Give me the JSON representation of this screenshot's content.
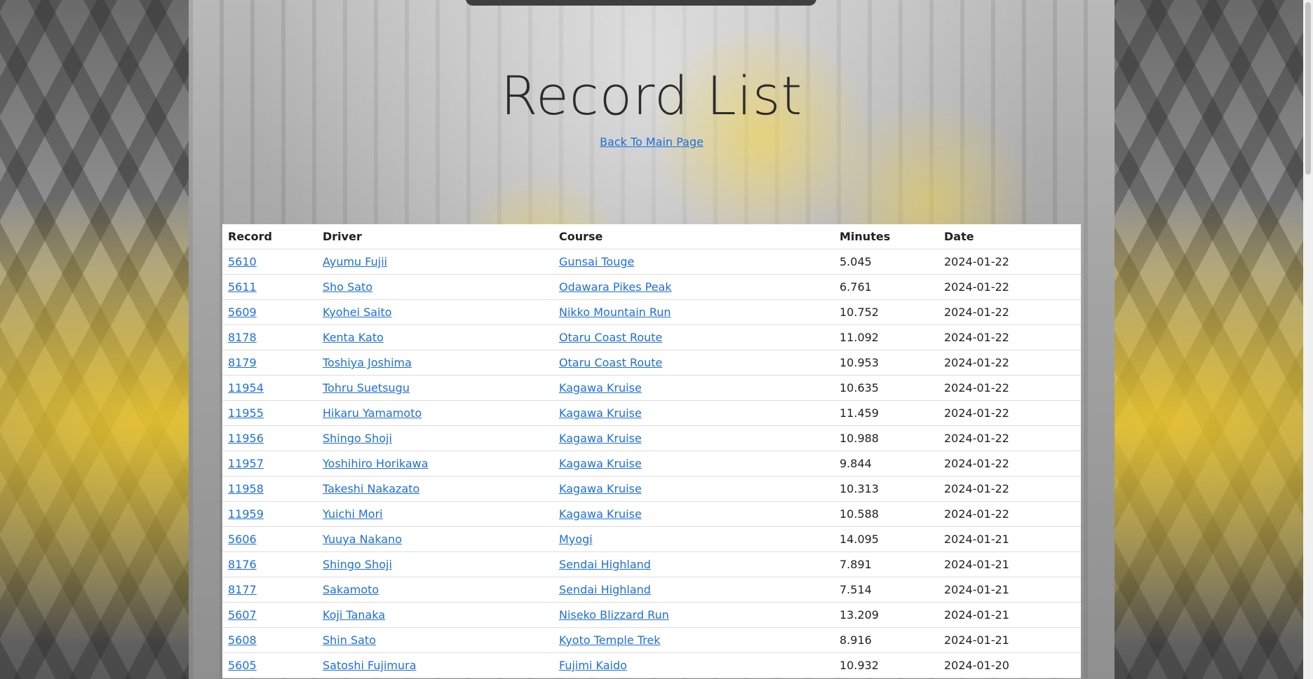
{
  "title": "Record List",
  "back_link": "Back To Main Page",
  "table": {
    "headers": [
      "Record",
      "Driver",
      "Course",
      "Minutes",
      "Date"
    ],
    "rows": [
      {
        "record": "5610",
        "driver": "Ayumu Fujii",
        "course": "Gunsai Touge",
        "minutes": "5.045",
        "date": "2024-01-22"
      },
      {
        "record": "5611",
        "driver": "Sho Sato",
        "course": "Odawara Pikes Peak",
        "minutes": "6.761",
        "date": "2024-01-22"
      },
      {
        "record": "5609",
        "driver": "Kyohei Saito",
        "course": "Nikko Mountain Run",
        "minutes": "10.752",
        "date": "2024-01-22"
      },
      {
        "record": "8178",
        "driver": "Kenta Kato",
        "course": "Otaru Coast Route",
        "minutes": "11.092",
        "date": "2024-01-22"
      },
      {
        "record": "8179",
        "driver": "Toshiya Joshima",
        "course": "Otaru Coast Route",
        "minutes": "10.953",
        "date": "2024-01-22"
      },
      {
        "record": "11954",
        "driver": "Tohru Suetsugu",
        "course": "Kagawa Kruise",
        "minutes": "10.635",
        "date": "2024-01-22"
      },
      {
        "record": "11955",
        "driver": "Hikaru Yamamoto",
        "course": "Kagawa Kruise",
        "minutes": "11.459",
        "date": "2024-01-22"
      },
      {
        "record": "11956",
        "driver": "Shingo Shoji",
        "course": "Kagawa Kruise",
        "minutes": "10.988",
        "date": "2024-01-22"
      },
      {
        "record": "11957",
        "driver": "Yoshihiro Horikawa",
        "course": "Kagawa Kruise",
        "minutes": "9.844",
        "date": "2024-01-22"
      },
      {
        "record": "11958",
        "driver": "Takeshi Nakazato",
        "course": "Kagawa Kruise",
        "minutes": "10.313",
        "date": "2024-01-22"
      },
      {
        "record": "11959",
        "driver": "Yuichi Mori",
        "course": "Kagawa Kruise",
        "minutes": "10.588",
        "date": "2024-01-22"
      },
      {
        "record": "5606",
        "driver": "Yuuya Nakano",
        "course": "Myogi",
        "minutes": "14.095",
        "date": "2024-01-21"
      },
      {
        "record": "8176",
        "driver": "Shingo Shoji",
        "course": "Sendai Highland",
        "minutes": "7.891",
        "date": "2024-01-21"
      },
      {
        "record": "8177",
        "driver": "Sakamoto",
        "course": "Sendai Highland",
        "minutes": "7.514",
        "date": "2024-01-21"
      },
      {
        "record": "5607",
        "driver": "Koji Tanaka",
        "course": "Niseko Blizzard Run",
        "minutes": "13.209",
        "date": "2024-01-21"
      },
      {
        "record": "5608",
        "driver": "Shin Sato",
        "course": "Kyoto Temple Trek",
        "minutes": "8.916",
        "date": "2024-01-21"
      },
      {
        "record": "5605",
        "driver": "Satoshi Fujimura",
        "course": "Fujimi Kaido",
        "minutes": "10.932",
        "date": "2024-01-20"
      }
    ]
  }
}
